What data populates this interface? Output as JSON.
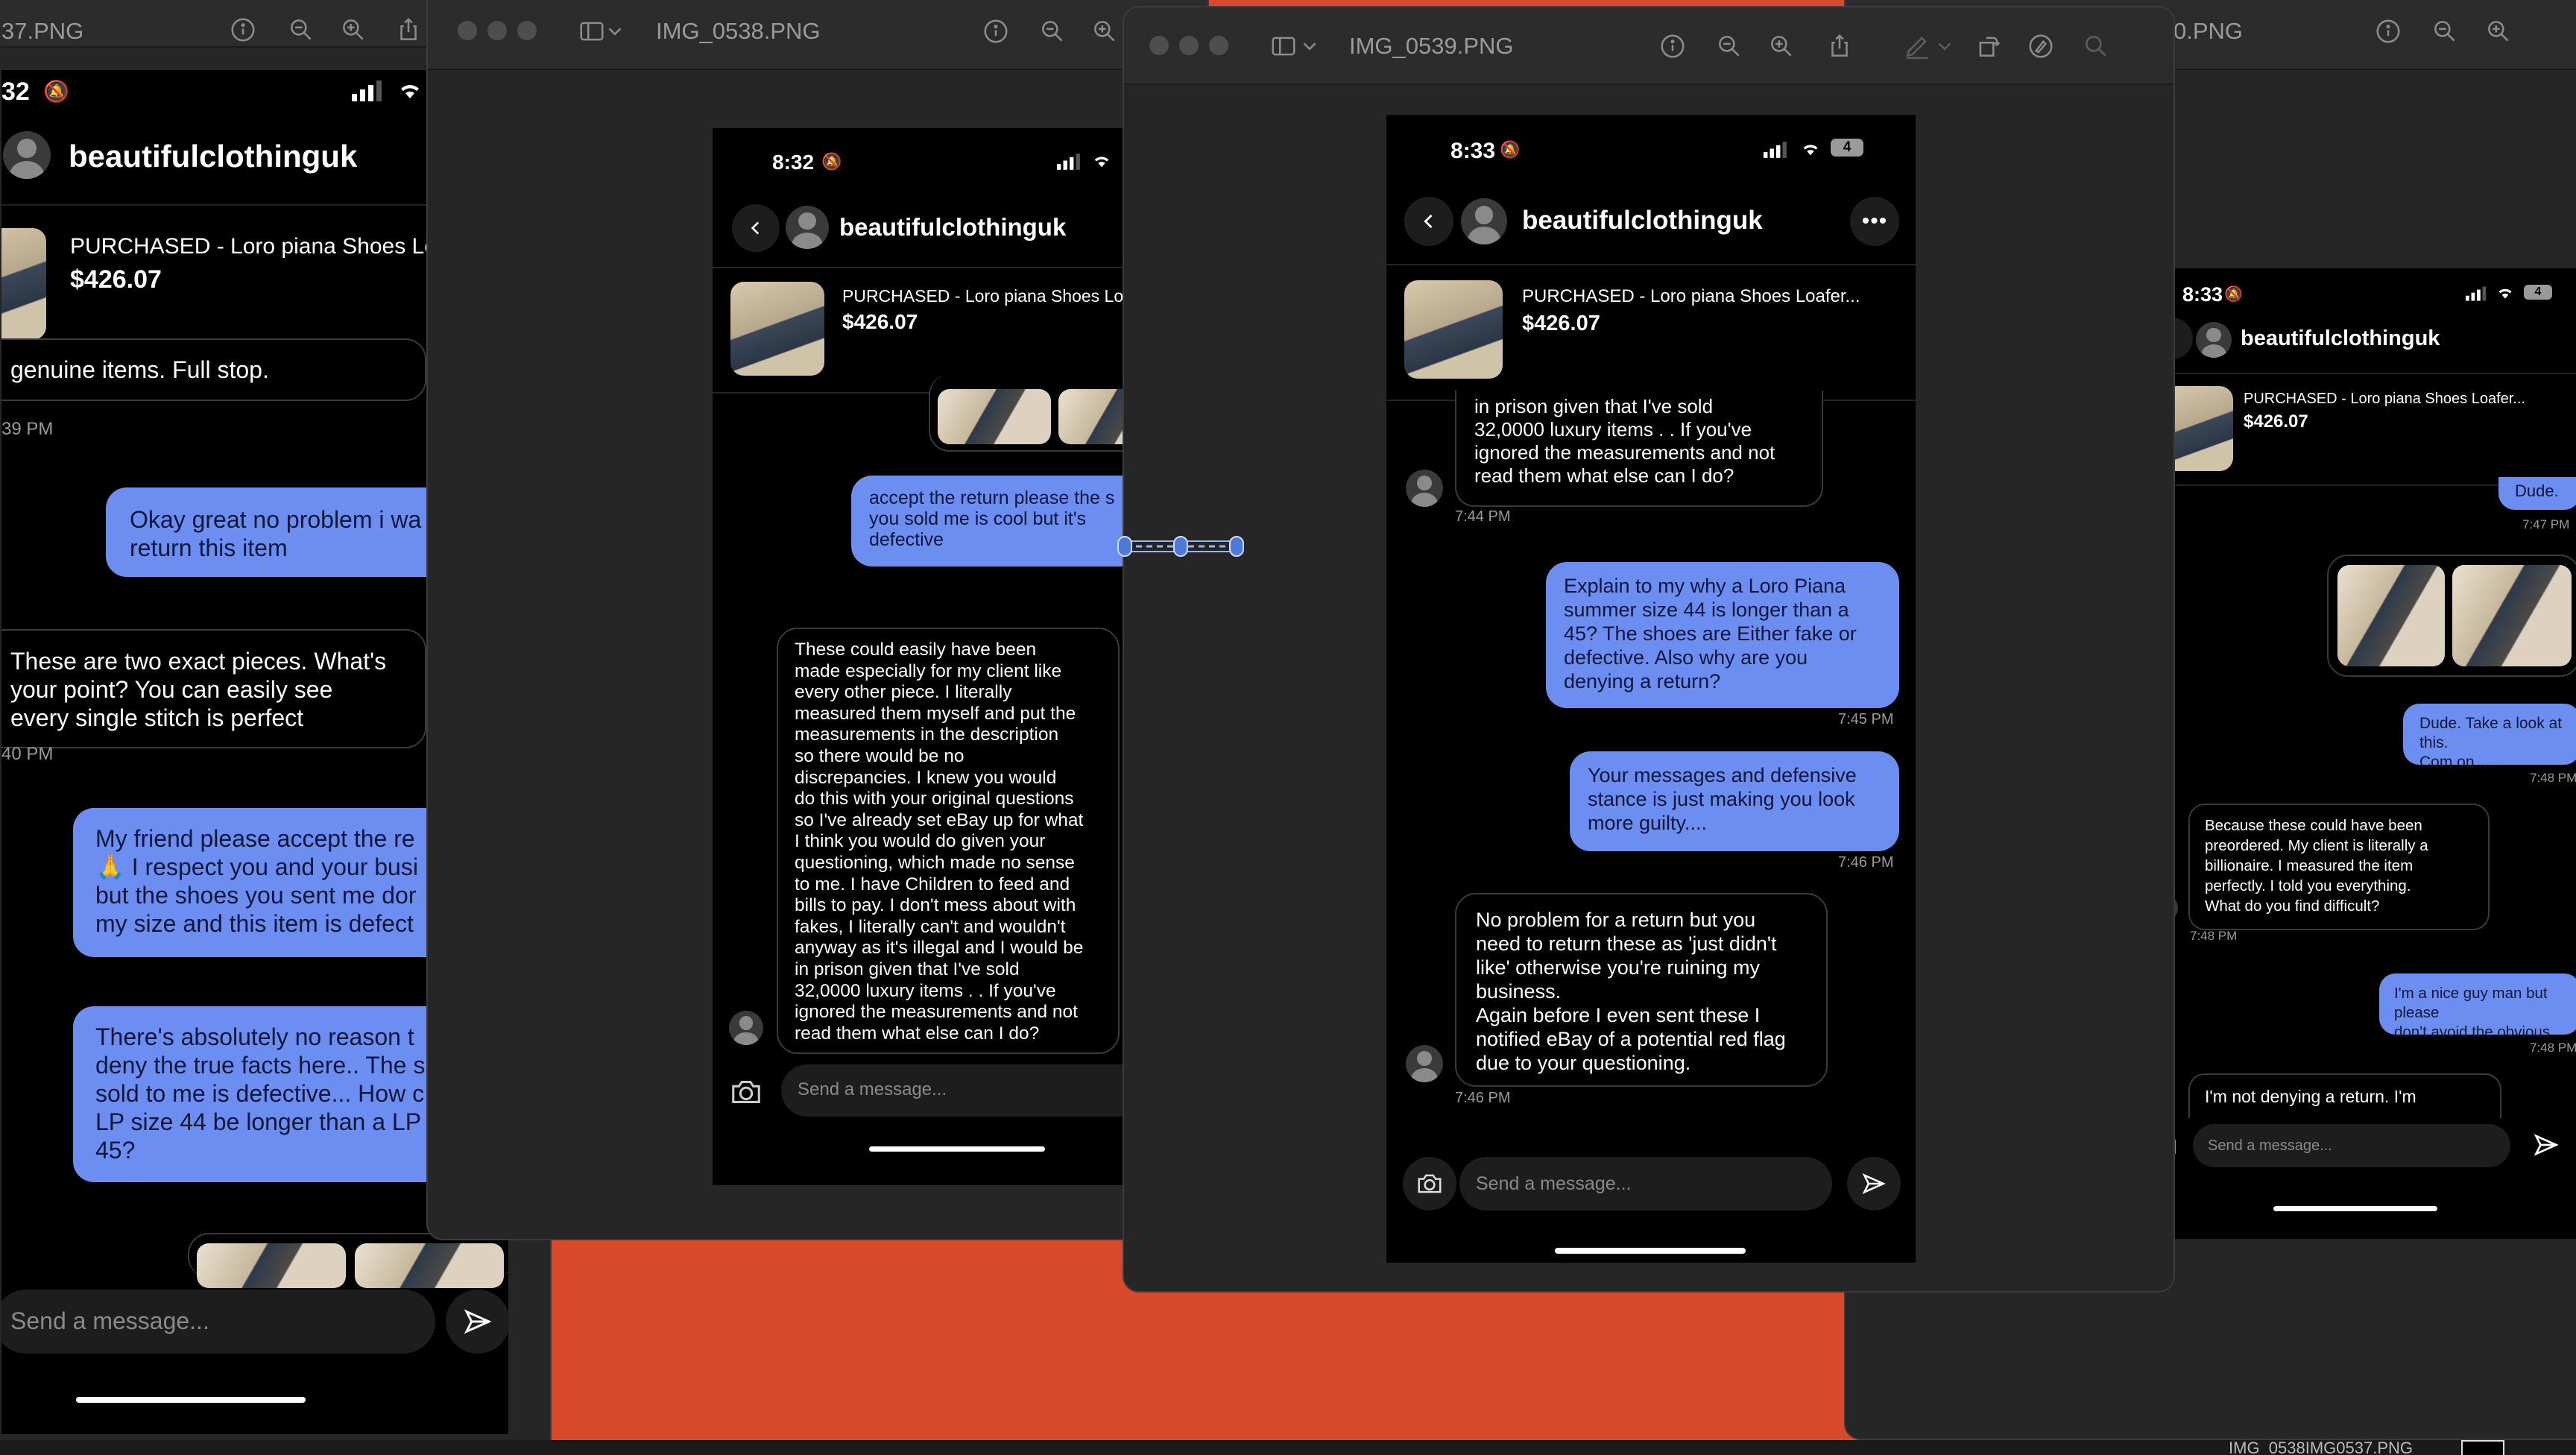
{
  "windows": {
    "w1": {
      "title": "37.PNG"
    },
    "w2": {
      "title": "IMG_0538.PNG"
    },
    "w3": {
      "title": "IMG_0539.PNG"
    },
    "w4": {
      "title": "0.PNG"
    }
  },
  "chat": {
    "username": "beautifulclothinguk",
    "listing_title": "PURCHASED - Loro piana Shoes Loafer...",
    "listing_title_cut": "PURCHASED - Loro piana Shoes Loaf",
    "listing_title_cut_short": "PURCHASED - Loro piana Shoes Loaf",
    "price": "$426.07",
    "input_placeholder": "Send a message..."
  },
  "phone1": {
    "time": "32",
    "bubbles": [
      {
        "text": "genuine items. Full stop."
      },
      {
        "text": "Okay great no problem i wa\nreturn this item"
      },
      {
        "text": "These are two exact pieces. What's\nyour point? You can easily see\nevery single stitch is perfect"
      },
      {
        "text": "My friend please accept the re\n🙏 I respect you and your busi\nbut the shoes you sent me dor\nmy size and this item is defect"
      },
      {
        "text": "There's absolutely no reason t\ndeny the true facts here.. The s\nsold to me is defective... How c\nLP size 44 be longer than a LP\n45?"
      }
    ],
    "timestamps": [
      "39 PM",
      "40 PM"
    ]
  },
  "phone2": {
    "time": "8:32",
    "bubbles": [
      {
        "text": "accept the return please the s\nyou sold me is cool but it's\ndefective"
      },
      {
        "text": "These could easily have been\nmade especially for my client like\nevery other piece. I literally\nmeasured them myself and put the\nmeasurements in the description\nso there would be no\ndiscrepancies. I knew you would\ndo this with your original questions\nso I've already set eBay up for what\nI think you would do given your\nquestioning, which made no sense\nto me. I have Children to feed and\nbills to pay. I don't mess about with\nfakes, I literally can't and wouldn't\nanyway as it's illegal and I would be\nin prison given that I've sold\n32,0000 luxury items . . If you've\nignored the measurements and not\nread them what else can I do?"
      }
    ]
  },
  "phone3": {
    "time": "8:33",
    "battery": "4",
    "bubbles": [
      {
        "text": "in prison given that I've sold\n32,0000 luxury items . . If you've\nignored the measurements and not\nread them what else can I do?"
      },
      {
        "text": "Explain to my why a Loro Piana\nsummer size 44 is longer than a\n45? The shoes are   Either fake or\ndefective. Also why are you\ndenying a return?"
      },
      {
        "text": "Your messages and defensive\nstance is just making you look\nmore guilty...."
      },
      {
        "text": "No problem for a return but you\nneed to return these as 'just didn't\nlike' otherwise you're ruining my\nbusiness.\nAgain before I even sent these I\nnotified eBay of a potential red flag\ndue to your questioning."
      }
    ],
    "timestamps": [
      "7:44 PM",
      "7:45 PM",
      "7:46 PM",
      "7:46 PM"
    ]
  },
  "phone4": {
    "time": "8:33",
    "battery": "4",
    "bubbles": [
      {
        "text": "Dude."
      },
      {
        "text": "Dude. Take a look at this.\nCom on....."
      },
      {
        "text": "Because these could have been\npreordered. My client is literally a\nbillionaire. I measured the item\nperfectly. I told you everything.\nWhat do you find difficult?"
      },
      {
        "text": "I'm a nice guy man but please\ndon't avoid the obvious"
      },
      {
        "text": "I'm not denying a return. I'm"
      }
    ],
    "timestamps": [
      "7:47 PM",
      "7:48 PM",
      "7:48 PM",
      "7:48 PM"
    ]
  },
  "bottom_bar": {
    "text": "IMG_0538IMG0537.PNG"
  }
}
